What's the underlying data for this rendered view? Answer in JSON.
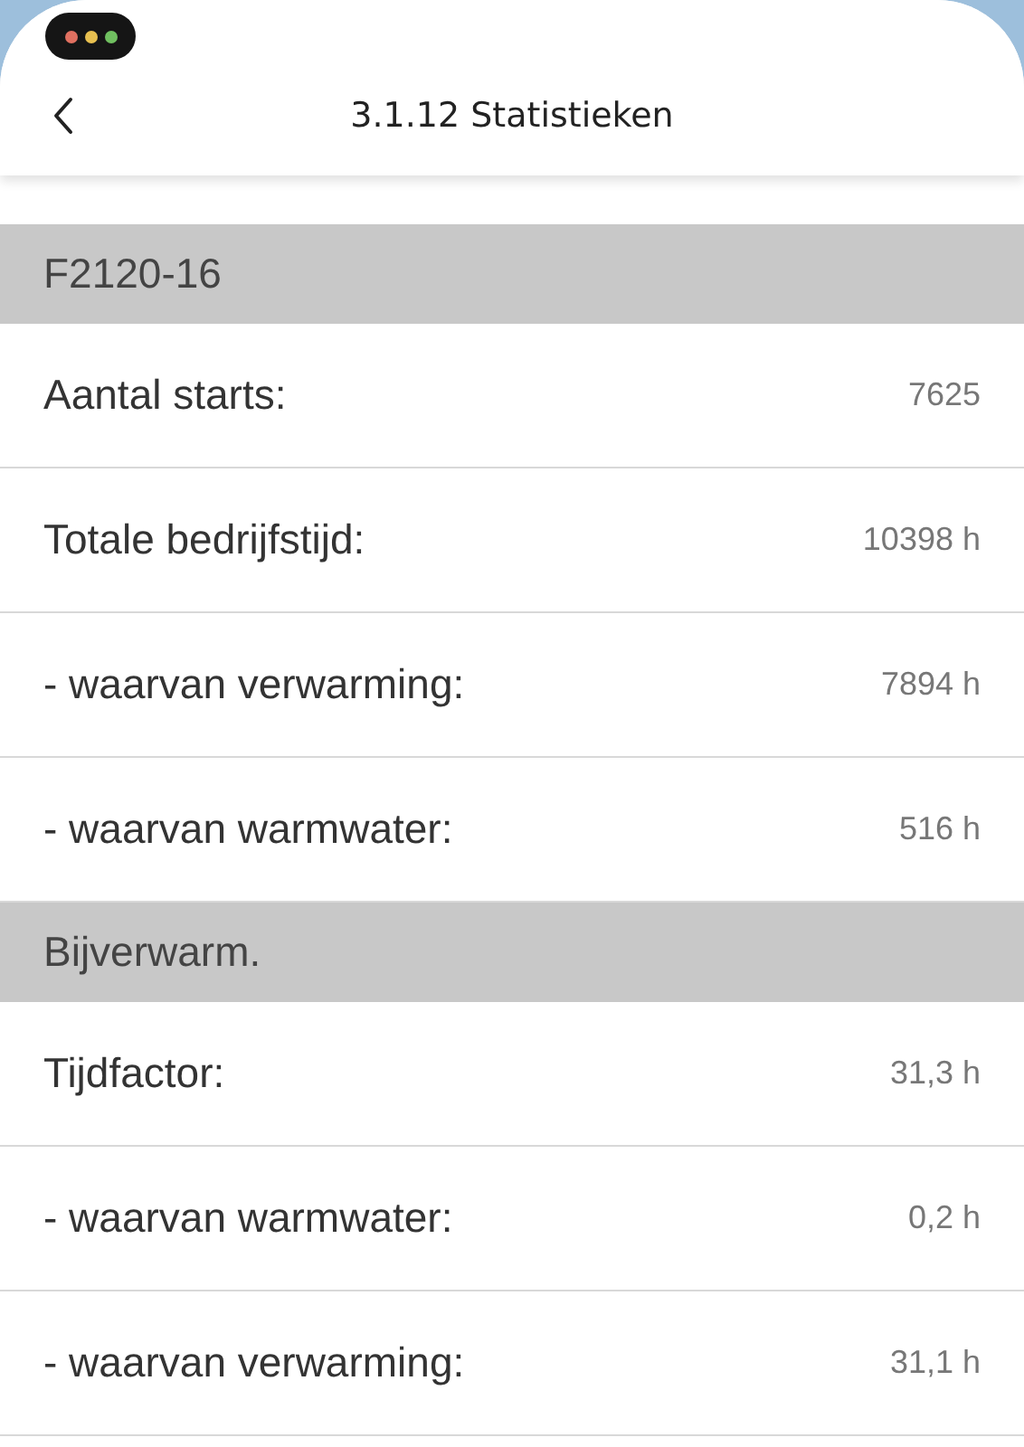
{
  "header": {
    "title": "3.1.12 Statistieken"
  },
  "sections": [
    {
      "title": "F2120-16",
      "rows": [
        {
          "label": "Aantal starts:",
          "value": "7625"
        },
        {
          "label": "Totale bedrijfstijd:",
          "value": "10398 h"
        },
        {
          "label": "- waarvan verwarming:",
          "value": "7894 h"
        },
        {
          "label": "- waarvan warmwater:",
          "value": "516 h"
        }
      ]
    },
    {
      "title": "Bijverwarm.",
      "rows": [
        {
          "label": "Tijdfactor:",
          "value": "31,3 h"
        },
        {
          "label": "- waarvan warmwater:",
          "value": "0,2 h"
        },
        {
          "label": "- waarvan verwarming:",
          "value": "31,1 h"
        }
      ]
    }
  ]
}
